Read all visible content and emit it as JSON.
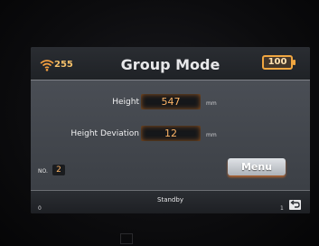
{
  "header": {
    "signal_value": "255",
    "title": "Group Mode",
    "battery": "100"
  },
  "fields": {
    "height_label": "Height",
    "height_value": "547",
    "height_unit": "mm",
    "deviation_label": "Height Deviation",
    "deviation_value": "12",
    "deviation_unit": "mm"
  },
  "group": {
    "no_label": "NO.",
    "no_value": "2"
  },
  "menu": {
    "label": "Menu"
  },
  "status": {
    "text": "Standby",
    "left_mark": "0",
    "right_mark": "1"
  },
  "colors": {
    "accent": "#f0a640",
    "value_text": "#ffb566"
  },
  "icons": {
    "signal": "wifi-icon",
    "battery": "battery-icon",
    "back": "back-icon"
  }
}
